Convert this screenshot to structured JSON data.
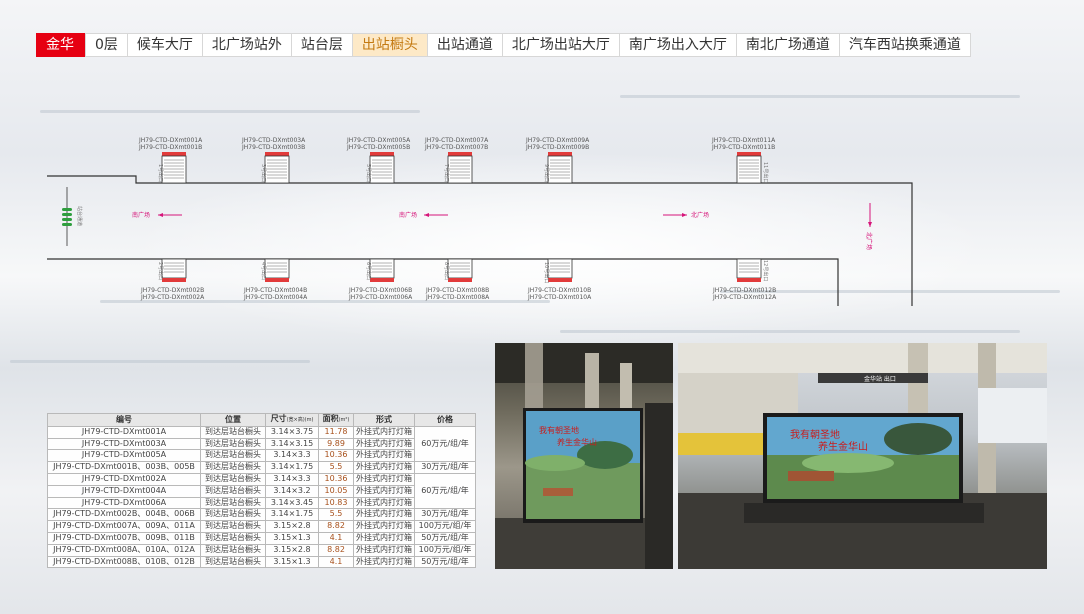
{
  "tabs": [
    {
      "label": "金华",
      "state": "brand"
    },
    {
      "label": "0层",
      "state": ""
    },
    {
      "label": "候车大厅",
      "state": ""
    },
    {
      "label": "北广场站外",
      "state": ""
    },
    {
      "label": "站台层",
      "state": ""
    },
    {
      "label": "出站橱头",
      "state": "active"
    },
    {
      "label": "出站通道",
      "state": ""
    },
    {
      "label": "北广场出站大厅",
      "state": ""
    },
    {
      "label": "南广场出入大厅",
      "state": ""
    },
    {
      "label": "南北广场通道",
      "state": ""
    },
    {
      "label": "汽车西站换乘通道",
      "state": ""
    }
  ],
  "map": {
    "top_units": [
      {
        "l1": "JH79-CTD-DXmt001A",
        "l2": "JH79-CTD-DXmt001B",
        "s": "1号出口"
      },
      {
        "l1": "JH79-CTD-DXmt003A",
        "l2": "JH79-CTD-DXmt003B",
        "s": "3号出口"
      },
      {
        "l1": "JH79-CTD-DXmt005A",
        "l2": "JH79-CTD-DXmt005B",
        "s": "5号出口"
      },
      {
        "l1": "JH79-CTD-DXmt007A",
        "l2": "JH79-CTD-DXmt007B",
        "s": "7号出口"
      },
      {
        "l1": "JH79-CTD-DXmt009A",
        "l2": "JH79-CTD-DXmt009B",
        "s": "9号出口"
      },
      {
        "l1": "JH79-CTD-DXmt011A",
        "l2": "JH79-CTD-DXmt011B",
        "s": "11号出口"
      }
    ],
    "bottom_units": [
      {
        "l1": "JH79-CTD-DXmt002B",
        "l2": "JH79-CTD-DXmt002A",
        "s": "2号出口"
      },
      {
        "l1": "JH79-CTD-DXmt004B",
        "l2": "JH79-CTD-DXmt004A",
        "s": "4号出口"
      },
      {
        "l1": "JH79-CTD-DXmt006B",
        "l2": "JH79-CTD-DXmt006A",
        "s": "6号出口"
      },
      {
        "l1": "JH79-CTD-DXmt008B",
        "l2": "JH79-CTD-DXmt008A",
        "s": "8号出口"
      },
      {
        "l1": "JH79-CTD-DXmt010B",
        "l2": "JH79-CTD-DXmt010A",
        "s": "10号出口"
      },
      {
        "l1": "JH79-CTD-DXmt012B",
        "l2": "JH79-CTD-DXmt012A",
        "s": "12号出口"
      }
    ],
    "dir_south_1": "南广场",
    "dir_south_2": "南广场",
    "dir_north_1": "北广场",
    "dir_north_2": "北广场",
    "stair_label": "站台通道"
  },
  "table": {
    "headers": {
      "id": "编号",
      "pos": "位置",
      "size": "尺寸",
      "size_unit": "(宽×高)(m)",
      "area": "面积",
      "area_unit": "(m²)",
      "form": "形式",
      "price": "价格"
    },
    "rows": [
      {
        "id": "JH79-CTD-DXmt001A",
        "pos": "到达层站台橱头",
        "size": "3.14×3.75",
        "area": "11.78",
        "form": "外挂式内打灯箱"
      },
      {
        "id": "JH79-CTD-DXmt003A",
        "pos": "到达层站台橱头",
        "size": "3.14×3.15",
        "area": "9.89",
        "form": "外挂式内打灯箱"
      },
      {
        "id": "JH79-CTD-DXmt005A",
        "pos": "到达层站台橱头",
        "size": "3.14×3.3",
        "area": "10.36",
        "form": "外挂式内打灯箱"
      },
      {
        "id": "JH79-CTD-DXmt001B、003B、005B",
        "pos": "到达层站台橱头",
        "size": "3.14×1.75",
        "area": "5.5",
        "form": "外挂式内打灯箱"
      },
      {
        "id": "JH79-CTD-DXmt002A",
        "pos": "到达层站台橱头",
        "size": "3.14×3.3",
        "area": "10.36",
        "form": "外挂式内打灯箱"
      },
      {
        "id": "JH79-CTD-DXmt004A",
        "pos": "到达层站台橱头",
        "size": "3.14×3.2",
        "area": "10.05",
        "form": "外挂式内打灯箱"
      },
      {
        "id": "JH79-CTD-DXmt006A",
        "pos": "到达层站台橱头",
        "size": "3.14×3.45",
        "area": "10.83",
        "form": "外挂式内打灯箱"
      },
      {
        "id": "JH79-CTD-DXmt002B、004B、006B",
        "pos": "到达层站台橱头",
        "size": "3.14×1.75",
        "area": "5.5",
        "form": "外挂式内打灯箱"
      },
      {
        "id": "JH79-CTD-DXmt007A、009A、011A",
        "pos": "到达层站台橱头",
        "size": "3.15×2.8",
        "area": "8.82",
        "form": "外挂式内打灯箱"
      },
      {
        "id": "JH79-CTD-DXmt007B、009B、011B",
        "pos": "到达层站台橱头",
        "size": "3.15×1.3",
        "area": "4.1",
        "form": "外挂式内打灯箱"
      },
      {
        "id": "JH79-CTD-DXmt008A、010A、012A",
        "pos": "到达层站台橱头",
        "size": "3.15×2.8",
        "area": "8.82",
        "form": "外挂式内打灯箱"
      },
      {
        "id": "JH79-CTD-DXmt008B、010B、012B",
        "pos": "到达层站台橱头",
        "size": "3.15×1.3",
        "area": "4.1",
        "form": "外挂式内打灯箱"
      }
    ],
    "prices": [
      "60万元/组/年",
      "30万元/组/年",
      "60万元/组/年",
      "30万元/组/年",
      "100万元/组/年",
      "50万元/组/年",
      "100万元/组/年",
      "50万元/组/年"
    ]
  },
  "photos": {
    "ad_line1": "我有朝圣地",
    "ad_line2": "养生金华山",
    "sign_text": "金华站 出口"
  }
}
